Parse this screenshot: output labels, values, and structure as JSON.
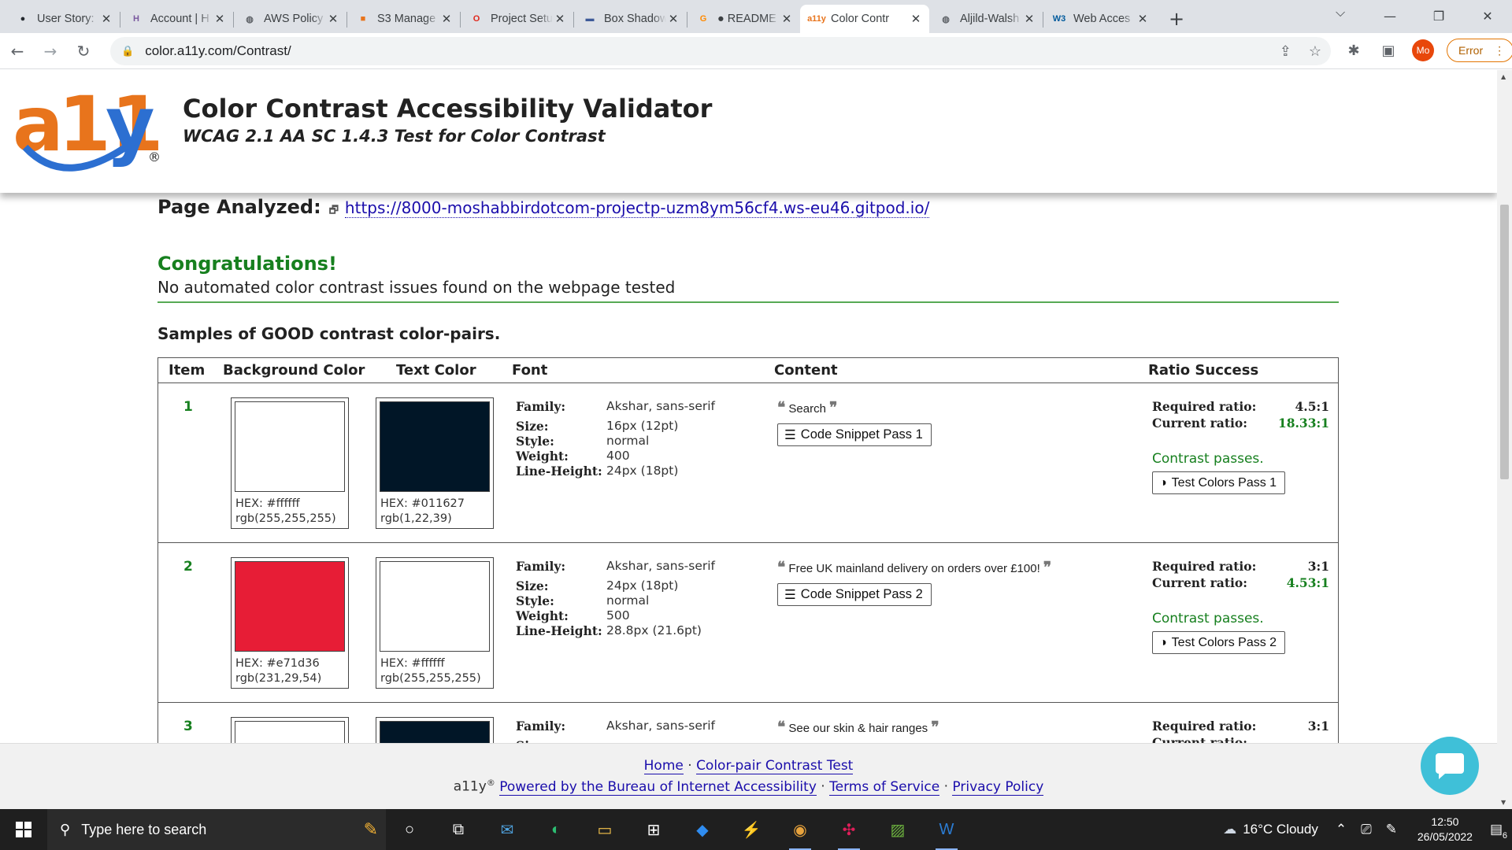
{
  "browser": {
    "tabs": [
      {
        "title": "User Story:",
        "icon": "github-icon",
        "color": "#24292f",
        "glyph": "●"
      },
      {
        "title": "Account | H",
        "icon": "heroku-icon",
        "color": "#79589f",
        "glyph": "H"
      },
      {
        "title": "AWS Policy",
        "icon": "globe-icon",
        "color": "#5f6368",
        "glyph": "◍"
      },
      {
        "title": "S3 Manage",
        "icon": "aws-icon",
        "color": "#e8741c",
        "glyph": "■"
      },
      {
        "title": "Project Setu",
        "icon": "opera-icon",
        "color": "#e0281c",
        "glyph": "O"
      },
      {
        "title": "Box Shadow",
        "icon": "box-shadow-icon",
        "color": "#3d5a98",
        "glyph": "▬"
      },
      {
        "title": "● README",
        "icon": "gitpod-icon",
        "color": "#ff8a00",
        "glyph": "G"
      },
      {
        "title": "Color Contr",
        "icon": "a11y-icon",
        "color": "#e8741c",
        "glyph": "a11y",
        "active": true
      },
      {
        "title": "Aljild-Walsh",
        "icon": "globe-icon",
        "color": "#5f6368",
        "glyph": "◍"
      },
      {
        "title": "Web Acces",
        "icon": "w3c-icon",
        "color": "#005a9c",
        "glyph": "W3"
      }
    ],
    "url": "color.a11y.com/Contrast/",
    "profile_initials": "Mo",
    "error_label": "Error"
  },
  "header": {
    "title": "Color Contrast Accessibility Validator",
    "subtitle": "WCAG 2.1 AA SC 1.4.3 Test for Color Contrast"
  },
  "page": {
    "analyzed_label": "Page Analyzed:",
    "analyzed_url": "https://8000-moshabbirdotcom-projectp-uzm8ym56cf4.ws-eu46.gitpod.io/",
    "congrats": "Congratulations!",
    "no_issues": "No automated color contrast issues found on the webpage tested",
    "samples_heading": "Samples of GOOD contrast color-pairs."
  },
  "table": {
    "headers": {
      "item": "Item",
      "background": "Background Color",
      "text": "Text Color",
      "font": "Font",
      "content": "Content",
      "ratio": "Ratio Success"
    },
    "labels": {
      "family": "Family:",
      "size": "Size:",
      "style": "Style:",
      "weight": "Weight:",
      "line_height": "Line-Height:",
      "required": "Required ratio:",
      "current": "Current ratio:"
    },
    "rows": [
      {
        "num": "1",
        "bg_hex": "HEX: #ffffff",
        "bg_rgb": "rgb(255,255,255)",
        "bg_color": "#ffffff",
        "fg_hex": "HEX: #011627",
        "fg_rgb": "rgb(1,22,39)",
        "fg_color": "#011627",
        "family": "Akshar, sans-serif",
        "size": "16px (12pt)",
        "style": "normal",
        "weight": "400",
        "line_height": "24px (18pt)",
        "content": "Search",
        "snippet_label": "Code Snippet Pass 1",
        "required": "4.5:1",
        "current": "18.33:1",
        "status": "Contrast passes.",
        "test_label": "Test Colors Pass 1"
      },
      {
        "num": "2",
        "bg_hex": "HEX: #e71d36",
        "bg_rgb": "rgb(231,29,54)",
        "bg_color": "#e71d36",
        "fg_hex": "HEX: #ffffff",
        "fg_rgb": "rgb(255,255,255)",
        "fg_color": "#ffffff",
        "family": "Akshar, sans-serif",
        "size": "24px (18pt)",
        "style": "normal",
        "weight": "500",
        "line_height": "28.8px (21.6pt)",
        "content": "Free UK mainland delivery on orders over £100!",
        "snippet_label": "Code Snippet Pass 2",
        "required": "3:1",
        "current": "4.53:1",
        "status": "Contrast passes.",
        "test_label": "Test Colors Pass 2"
      },
      {
        "num": "3",
        "bg_hex": "",
        "bg_rgb": "",
        "bg_color": "#ffffff",
        "fg_hex": "",
        "fg_rgb": "",
        "fg_color": "#011627",
        "family": "Akshar, sans-serif",
        "size": "",
        "style": "",
        "weight": "",
        "line_height": "",
        "content": "See our skin & hair ranges",
        "snippet_label": "",
        "required": "3:1",
        "current": "",
        "status": "",
        "test_label": ""
      }
    ]
  },
  "footer": {
    "home": "Home",
    "sep": "·",
    "contrast_test": "Color-pair Contrast Test",
    "brand": "a11y",
    "reg": "®",
    "powered": "Powered by the Bureau of Internet Accessibility",
    "terms": "Terms of Service",
    "privacy": "Privacy Policy"
  },
  "taskbar": {
    "search_placeholder": "Type here to search",
    "weather": "16°C  Cloudy",
    "time": "12:50",
    "date": "26/05/2022",
    "notifications": "6"
  },
  "colors": {
    "pass_green": "#17801f",
    "link_blue": "#1a0dab",
    "a11y_orange": "#e8741c",
    "a11y_blue": "#2c6fd1"
  }
}
